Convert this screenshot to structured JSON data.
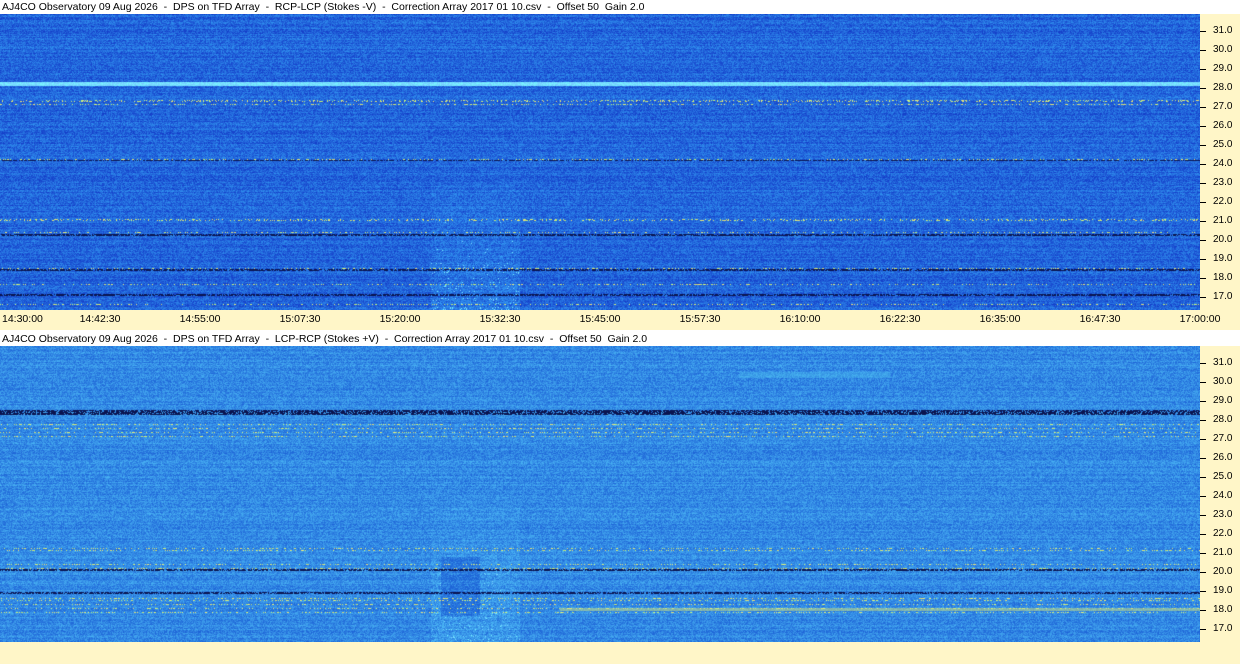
{
  "panel1": {
    "title": "AJ4CO Observatory 09 Aug 2026  -  DPS on TFD Array  -  RCP-LCP (Stokes -V)  -  Correction Array 2017 01 10.csv  -  Offset 50  Gain 2.0",
    "freq_labels": [
      "31.0",
      "30.0",
      "29.0",
      "28.0",
      "27.0",
      "26.0",
      "25.0",
      "24.0",
      "23.0",
      "22.0",
      "21.0",
      "20.0",
      "19.0",
      "18.0",
      "17.0"
    ]
  },
  "panel2": {
    "title": "AJ4CO Observatory 09 Aug 2026  -  DPS on TFD Array  -  LCP-RCP (Stokes +V)  -  Correction Array 2017 01 10.csv  -  Offset 50  Gain 2.0",
    "freq_labels": [
      "31.0",
      "30.0",
      "29.0",
      "28.0",
      "27.0",
      "26.0",
      "25.0",
      "24.0",
      "23.0",
      "22.0",
      "21.0",
      "20.0",
      "19.0",
      "18.0",
      "17.0"
    ]
  },
  "time_axis": {
    "labels": [
      "14:30:00",
      "14:42:30",
      "14:55:00",
      "15:07:30",
      "15:20:00",
      "15:32:30",
      "15:45:00",
      "15:57:30",
      "16:10:00",
      "16:22:30",
      "16:35:00",
      "16:47:30",
      "17:00:00"
    ]
  },
  "colors": {
    "axis_background": "#fff6c8",
    "spectrogram_base_panel1": "#1e4ed8",
    "spectrogram_base_panel2": "#2c6fe8"
  }
}
